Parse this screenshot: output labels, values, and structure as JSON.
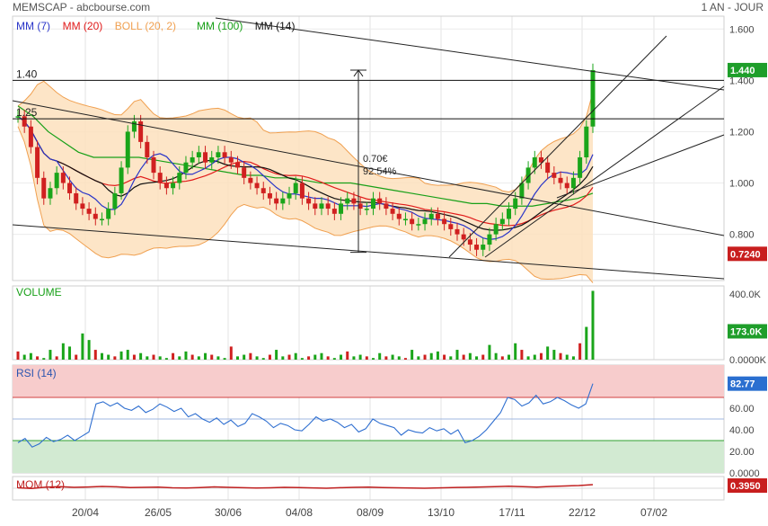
{
  "header": {
    "title": "MEMSCAP - abcbourse.com",
    "period": "1 AN - JOUR"
  },
  "legend": [
    {
      "label": "MM (7)",
      "color": "#2a35c8"
    },
    {
      "label": "MM (20)",
      "color": "#e01b1b"
    },
    {
      "label": "BOLL (20, 2)",
      "color": "#f0a050"
    },
    {
      "label": "MM (100)",
      "color": "#18a018"
    },
    {
      "label": "MM (14)",
      "color": "#111111"
    }
  ],
  "colors": {
    "up": "#1aa51a",
    "down": "#d02020",
    "boll_fill": "#fde0bd",
    "boll_line": "#f0a050",
    "rsi_line": "#2f6fd0",
    "rsi_over": "#f7cccc",
    "rsi_under": "#d2ead2",
    "mom_line": "#c02020"
  },
  "hlines": [
    {
      "label": "1.40",
      "value": 1.4
    },
    {
      "label": "1.25",
      "value": 1.25
    }
  ],
  "measure": {
    "amount": "0.70€",
    "percent": "92.54%"
  },
  "chart_data": [
    {
      "type": "candlestick",
      "title": "MEMSCAP",
      "ylim": [
        0.62,
        1.65
      ],
      "ytick_labels": [
        "1.600",
        "1.400",
        "1.200",
        "1.000",
        "0.800"
      ],
      "ytick_values": [
        1.6,
        1.4,
        1.2,
        1.0,
        0.8
      ],
      "x_labels": [
        "20/04",
        "26/05",
        "30/06",
        "04/08",
        "08/09",
        "13/10",
        "17/11",
        "22/12",
        "07/02"
      ],
      "last_value_label": "1.440",
      "last_value": 1.44,
      "marker_label": "0.7240",
      "marker_value": 0.724,
      "closes": [
        1.26,
        1.22,
        1.14,
        1.02,
        0.94,
        0.98,
        1.04,
        1.0,
        0.96,
        0.92,
        0.9,
        0.88,
        0.86,
        0.86,
        0.9,
        0.96,
        1.06,
        1.2,
        1.24,
        1.16,
        1.1,
        1.04,
        1.0,
        0.98,
        1.0,
        1.04,
        1.08,
        1.1,
        1.12,
        1.08,
        1.1,
        1.12,
        1.1,
        1.08,
        1.06,
        1.02,
        1.0,
        0.98,
        0.96,
        0.94,
        0.92,
        0.94,
        0.96,
        1.0,
        0.94,
        0.92,
        0.9,
        0.92,
        0.9,
        0.88,
        0.92,
        0.94,
        0.92,
        0.9,
        0.9,
        0.94,
        0.92,
        0.9,
        0.88,
        0.86,
        0.86,
        0.84,
        0.84,
        0.86,
        0.88,
        0.86,
        0.84,
        0.82,
        0.8,
        0.78,
        0.76,
        0.74,
        0.76,
        0.8,
        0.84,
        0.86,
        0.9,
        0.94,
        1.0,
        1.06,
        1.1,
        1.08,
        1.04,
        1.02,
        1.0,
        0.98,
        1.02,
        1.1,
        1.22,
        1.44
      ],
      "ma100": [
        1.3,
        1.26,
        1.2,
        1.16,
        1.12,
        1.1,
        1.1,
        1.1,
        1.1,
        1.09,
        1.08,
        1.07,
        1.06,
        1.05,
        1.04,
        1.03,
        1.03,
        1.02,
        1.02,
        1.01,
        1.0,
        1.0,
        1.0,
        0.99,
        0.98,
        0.97,
        0.96,
        0.95,
        0.94,
        0.93,
        0.92,
        0.92,
        0.91,
        0.91,
        0.91,
        0.92,
        0.93,
        0.94,
        0.96
      ]
    },
    {
      "type": "bar",
      "title": "VOLUME",
      "ytick_labels": [
        "400.0K",
        "0.0000K"
      ],
      "ytick_values": [
        400,
        0
      ],
      "last_value_label": "173.0K",
      "values": [
        50,
        30,
        40,
        20,
        10,
        60,
        20,
        100,
        80,
        30,
        160,
        120,
        60,
        40,
        30,
        20,
        50,
        60,
        30,
        40,
        20,
        30,
        20,
        10,
        40,
        20,
        50,
        30,
        20,
        40,
        30,
        20,
        10,
        80,
        20,
        30,
        40,
        20,
        10,
        30,
        60,
        20,
        30,
        40,
        10,
        20,
        30,
        40,
        20,
        10,
        30,
        50,
        20,
        30,
        20,
        10,
        40,
        20,
        30,
        20,
        10,
        60,
        20,
        30,
        40,
        50,
        30,
        20,
        60,
        30,
        40,
        20,
        30,
        90,
        40,
        20,
        30,
        100,
        60,
        20,
        30,
        40,
        80,
        60,
        40,
        30,
        20,
        100,
        200,
        420
      ]
    },
    {
      "type": "line",
      "title": "RSI (14)",
      "ylim": [
        0,
        100
      ],
      "ytick_labels": [
        "60.00",
        "40.00",
        "20.00",
        "0.0000"
      ],
      "ytick_values": [
        60,
        40,
        20,
        0
      ],
      "last_value_label": "82.77",
      "values": [
        28,
        32,
        24,
        27,
        33,
        29,
        31,
        35,
        30,
        34,
        38,
        64,
        66,
        62,
        65,
        60,
        58,
        62,
        56,
        59,
        64,
        61,
        57,
        60,
        52,
        55,
        50,
        47,
        51,
        45,
        49,
        43,
        46,
        55,
        52,
        48,
        42,
        46,
        44,
        40,
        39,
        45,
        52,
        48,
        50,
        47,
        42,
        45,
        38,
        41,
        50,
        46,
        44,
        42,
        35,
        40,
        38,
        37,
        42,
        39,
        41,
        36,
        40,
        28,
        30,
        34,
        40,
        48,
        56,
        70,
        68,
        62,
        65,
        72,
        64,
        66,
        70,
        67,
        63,
        60,
        64,
        82.77
      ]
    },
    {
      "type": "line",
      "title": "MOM (12)",
      "last_value_label": "0.3950",
      "values": [
        0.05,
        -0.02,
        0.12,
        0.18,
        0.1,
        0.14,
        0.2,
        0.16,
        0.08,
        0.1,
        0.12,
        0.05,
        0.02,
        0.08,
        0.15,
        0.1,
        0.06,
        0.02,
        0.05,
        0.1,
        0.08,
        0.04,
        0.0,
        0.06,
        0.1,
        0.12,
        0.08,
        0.05,
        0.02,
        0.0,
        0.04,
        0.08,
        0.1,
        0.14,
        0.18,
        0.22,
        0.18,
        0.12,
        0.2,
        0.25,
        0.3,
        0.395
      ]
    }
  ]
}
